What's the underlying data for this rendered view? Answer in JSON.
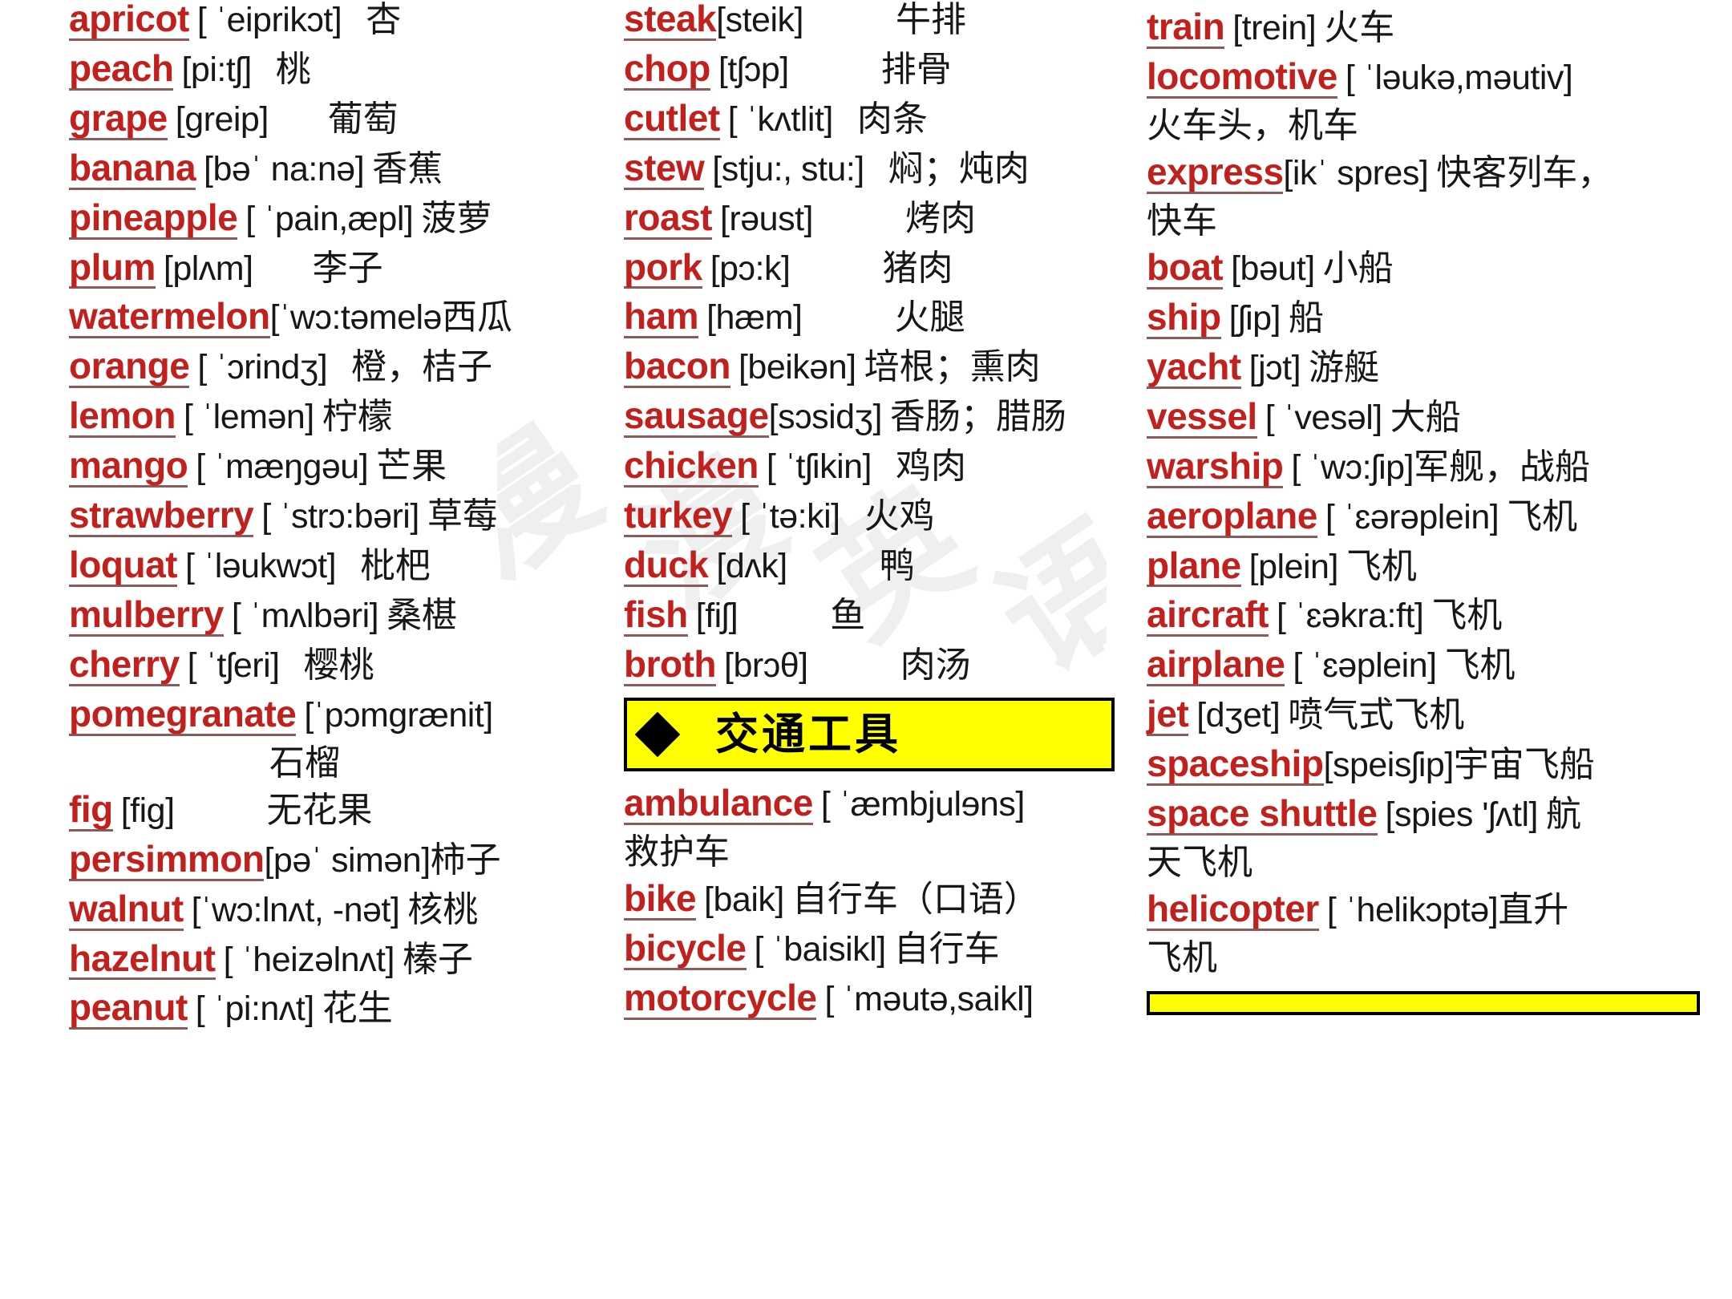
{
  "theme": {
    "word_color": "#c1201c",
    "text_color": "#171717",
    "banner_bg": "#ffff00",
    "banner_border": "#000000",
    "page_bg": "#ffffff"
  },
  "watermark": {
    "text": "漫漫英语"
  },
  "columns": {
    "fruits": {
      "name": "fruits-column",
      "entries": [
        {
          "word": "apricot",
          "phon": "[ ˈeiprikɔt]",
          "cn": "杏",
          "gap": "sm"
        },
        {
          "word": "peach",
          "phon": "[pi:tʃ]",
          "cn": "桃",
          "gap": "sm"
        },
        {
          "word": "grape",
          "phon": "[greip]",
          "cn": "葡萄",
          "gap": "lg"
        },
        {
          "word": "banana",
          "phon": "[bəˈ na:nə]",
          "cn": "香蕉",
          "gap": "sm"
        },
        {
          "word": "pineapple",
          "phon": "[ ˈpain,æpl]",
          "cn": "菠萝",
          "gap": "sm"
        },
        {
          "word": "plum",
          "phon": "[plʌm]",
          "cn": "李子",
          "gap": "lg"
        },
        {
          "word": "watermelon",
          "phon": "[ˈwɔ:təmelə",
          "cn": "西瓜",
          "gap": "none"
        },
        {
          "word": "orange",
          "phon": "[ ˈɔrindʒ]",
          "cn": "橙，桔子",
          "gap": "md"
        },
        {
          "word": "lemon",
          "phon": "[ ˈlemən]",
          "cn": "柠檬",
          "gap": "sm"
        },
        {
          "word": "mango",
          "phon": "[ ˈmæŋgəu]",
          "cn": "芒果",
          "gap": "sm"
        },
        {
          "word": "strawberry",
          "phon": "[ ˈstrɔ:bəri]",
          "cn": "草莓",
          "gap": "sm"
        },
        {
          "word": "loquat",
          "phon": "[ ˈləukwɔt]",
          "cn": "枇杷",
          "gap": "md"
        },
        {
          "word": "mulberry",
          "phon": "[ ˈmʌlbəri]",
          "cn": "桑椹",
          "gap": "sm"
        },
        {
          "word": "cherry",
          "phon": "[ ˈtʃeri]",
          "cn": "樱桃",
          "gap": "md"
        },
        {
          "word": "pomegranate",
          "phon": "[ˈpɔmgrænit]",
          "cn": "",
          "gap": "none",
          "cont": "石榴",
          "cont_indent": "indent"
        },
        {
          "word": "fig",
          "phon": "[fig]",
          "cn": "无花果",
          "gap": "xl"
        },
        {
          "word": "persimmon",
          "phon": "[pəˈ simən]",
          "cn": "柿子",
          "gap": "none"
        },
        {
          "word": "walnut",
          "phon": "[ˈwɔ:lnʌt, -nət]",
          "cn": "核桃",
          "gap": "sm"
        },
        {
          "word": "hazelnut",
          "phon": "[ ˈheizəlnʌt]",
          "cn": "榛子",
          "gap": "sm"
        },
        {
          "word": "peanut",
          "phon": "[ ˈpi:nʌt]",
          "cn": "花生",
          "gap": "sm"
        }
      ]
    },
    "meats": {
      "name": "meats-column",
      "entries": [
        {
          "word": "steak",
          "phon": "[steik]",
          "cn": "牛排",
          "gap": "xl"
        },
        {
          "word": "chop",
          "phon": "[tʃɔp]",
          "cn": "排骨",
          "gap": "xl"
        },
        {
          "word": "cutlet",
          "phon": "[ ˈkʌtlit]",
          "cn": "肉条",
          "gap": "md"
        },
        {
          "word": "stew",
          "phon": "[stju:, stu:]",
          "cn": "焖；炖肉",
          "gap": "md"
        },
        {
          "word": "roast",
          "phon": "[rəust]",
          "cn": "烤肉",
          "gap": "xl"
        },
        {
          "word": "pork",
          "phon": "[pɔ:k]",
          "cn": "猪肉",
          "gap": "xl"
        },
        {
          "word": "ham",
          "phon": "[hæm]",
          "cn": "火腿",
          "gap": "xl"
        },
        {
          "word": "bacon",
          "phon": "[beikən]",
          "cn": "培根；熏肉",
          "gap": "sm"
        },
        {
          "word": "sausage",
          "phon": "[sɔsidʒ]",
          "cn": "香肠；腊肠",
          "gap": "none"
        },
        {
          "word": "chicken",
          "phon": "[ ˈtʃikin]",
          "cn": "鸡肉",
          "gap": "md"
        },
        {
          "word": "turkey",
          "phon": "[ ˈtə:ki]",
          "cn": "火鸡",
          "gap": "md"
        },
        {
          "word": "duck",
          "phon": "[dʌk]",
          "cn": "鸭",
          "gap": "xl"
        },
        {
          "word": "fish",
          "phon": "[fiʃ]",
          "cn": "鱼",
          "gap": "xl"
        },
        {
          "word": "broth",
          "phon": "[brɔθ]",
          "cn": "肉汤",
          "gap": "xl"
        }
      ],
      "section": {
        "marker": "diamond-bullet",
        "title": "交通工具"
      },
      "vehicle_entries": [
        {
          "word": "ambulance",
          "phon": "[ ˈæmbjulɘns]",
          "cn": "",
          "gap": "none",
          "cont": "救护车",
          "cont_indent": "none"
        },
        {
          "word": "bike",
          "phon": "[baik]",
          "cn": "自行车（口语）",
          "gap": "sm"
        },
        {
          "word": "bicycle",
          "phon": "[ ˈbaisikl]",
          "cn": "自行车",
          "gap": "sm"
        },
        {
          "word": "motorcycle",
          "phon": "[ ˈməutə,saikl]",
          "cn": "",
          "gap": "none"
        }
      ]
    },
    "vehicles": {
      "name": "vehicles-column",
      "entries": [
        {
          "word": "train",
          "phon": "[trein]",
          "cn": "火车",
          "gap": "sm"
        },
        {
          "word": "locomotive",
          "phon": "[ ˈləukə,məutiv]",
          "cn": "",
          "gap": "none",
          "cont": "火车头，机车",
          "cont_indent": "none"
        },
        {
          "word": "express",
          "phon": "[ikˈ spres]",
          "cn": "快客列车，",
          "gap": "sm",
          "cont": "快车",
          "cont_indent": "none"
        },
        {
          "word": "boat",
          "phon": "[bəut]",
          "cn": "小船",
          "gap": "sm"
        },
        {
          "word": "ship",
          "phon": "[ʃip]",
          "cn": "船",
          "gap": "sm"
        },
        {
          "word": "yacht",
          "phon": "[jɔt]",
          "cn": "游艇",
          "gap": "sm"
        },
        {
          "word": "vessel",
          "phon": "[ ˈvesəl]",
          "cn": "大船",
          "gap": "sm"
        },
        {
          "word": "warship",
          "phon": "[ ˈwɔ:ʃip]",
          "cn": "军舰，战船",
          "gap": "none"
        },
        {
          "word": "aeroplane",
          "phon": "[ ˈɛərəplein]",
          "cn": "飞机",
          "gap": "sm"
        },
        {
          "word": "plane",
          "phon": "[plein]",
          "cn": "飞机",
          "gap": "sm"
        },
        {
          "word": "aircraft",
          "phon": "[ ˈɛəkra:ft]",
          "cn": "飞机",
          "gap": "sm"
        },
        {
          "word": "airplane",
          "phon": "[ ˈɛəplein]",
          "cn": "飞机",
          "gap": "sm"
        },
        {
          "word": "jet",
          "phon": "[dʒet]",
          "cn": "喷气式飞机",
          "gap": "sm"
        },
        {
          "word": "spaceship",
          "phon": "[speisʃip]",
          "cn": "宇宙飞船",
          "gap": "none"
        },
        {
          "word": "space shuttle",
          "phon": "[spies 'ʃʌtl]",
          "cn": "航",
          "gap": "sm",
          "cont": "天飞机",
          "cont_indent": "none"
        },
        {
          "word": "helicopter",
          "phon": "[ ˈhelikɔptə]",
          "cn": "直升",
          "gap": "none",
          "cont": "飞机",
          "cont_indent": "none"
        }
      ],
      "bottom_banner": {
        "name": "next-section-banner"
      }
    }
  }
}
